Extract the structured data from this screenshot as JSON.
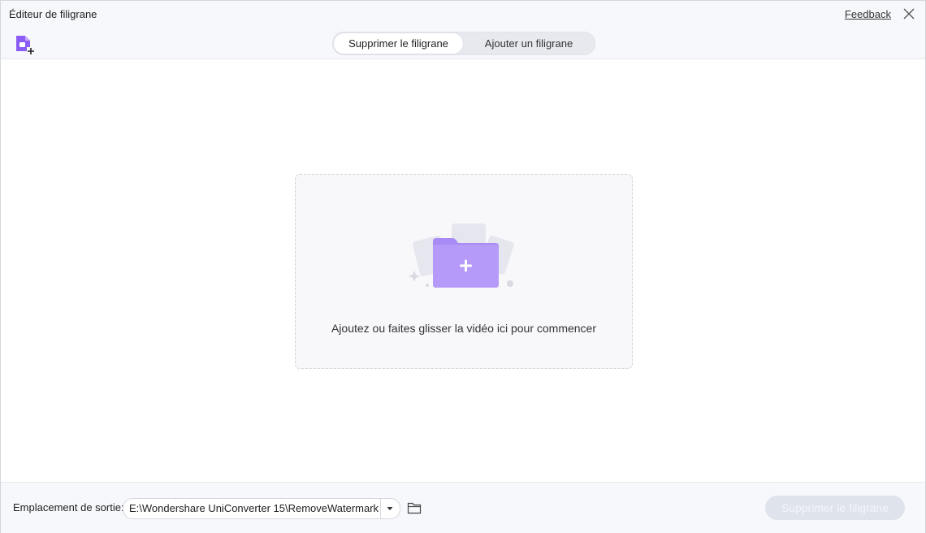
{
  "window": {
    "title": "Éditeur de filigrane",
    "feedback_label": "Feedback"
  },
  "tabs": [
    {
      "label": "Supprimer le filigrane",
      "active": true
    },
    {
      "label": "Ajouter un filigrane",
      "active": false
    }
  ],
  "dropzone": {
    "text": "Ajoutez ou faites glisser la vidéo ici pour commencer"
  },
  "footer": {
    "output_label": "Emplacement de sortie:",
    "output_path": "E:\\Wondershare UniConverter 15\\RemoveWatermark",
    "action_label": "Supprimer le filigrane",
    "action_enabled": false
  },
  "icons": {
    "add_file": "add-file-icon",
    "close": "close-icon",
    "dropdown": "chevron-down-icon",
    "folder": "folder-icon",
    "upload": "add-folder-icon"
  },
  "colors": {
    "accent": "#8b5cf6",
    "accent_light": "#c4a5ff",
    "disabled_button": "#dfe3ec"
  }
}
